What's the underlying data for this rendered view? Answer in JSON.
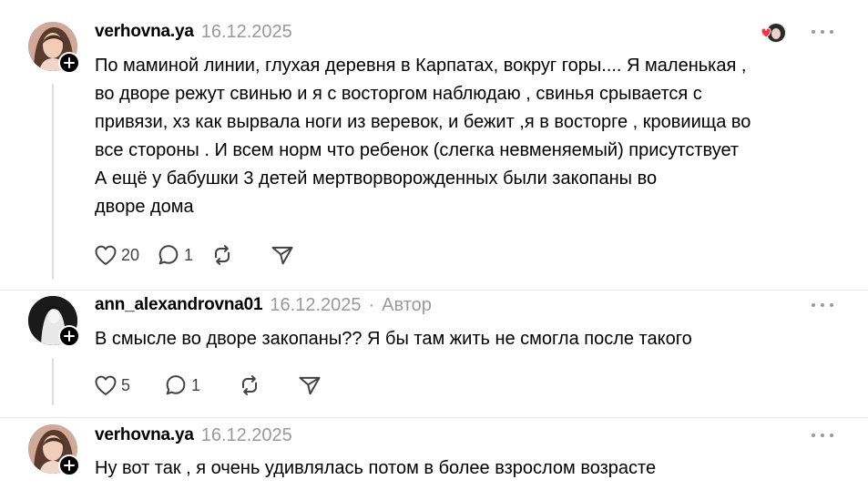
{
  "comments": [
    {
      "username": "verhovna.ya",
      "date": "16.12.2025",
      "text_lines": [
        "По маминой линии, глухая деревня в Карпатах, вокруг горы.... Я маленькая ,",
        "во дворе режут свинью и я с восторгом наблюдаю , свинья срывается с",
        "привязи, хз как вырвала ноги из веревок, и бежит ,я в восторге , кровиища во",
        "все стороны . И всем норм что ребенок (слегка невменяемый) присутствует",
        "А ещё у бабушки 3 детей мертворворожденных были закопаны во",
        "дворе дома"
      ],
      "likes": "20",
      "replies": "1"
    },
    {
      "username": "ann_alexandrovna01",
      "date": "16.12.2025",
      "separator": "·",
      "author_badge": "Автор",
      "text_lines": [
        "В смысле во дворе закопаны?? Я бы там жить не смогла после такого"
      ],
      "likes": "5",
      "replies": "1"
    },
    {
      "username": "verhovna.ya",
      "date": "16.12.2025",
      "text_lines": [
        "Ну вот так , я очень удивлялась потом в более взрослом возрасте"
      ]
    }
  ],
  "icons": {
    "like": "heart-icon",
    "reply": "comment-bubble-icon",
    "repost": "repost-arrows-icon",
    "share": "paper-plane-icon",
    "more": "more-horizontal-icon",
    "follow": "plus-icon",
    "liked_by_author": "heart-avatar-icon"
  },
  "colors": {
    "text": "#000000",
    "muted": "#999999",
    "line": "#dedede",
    "liked_heart": "#ff3040"
  }
}
